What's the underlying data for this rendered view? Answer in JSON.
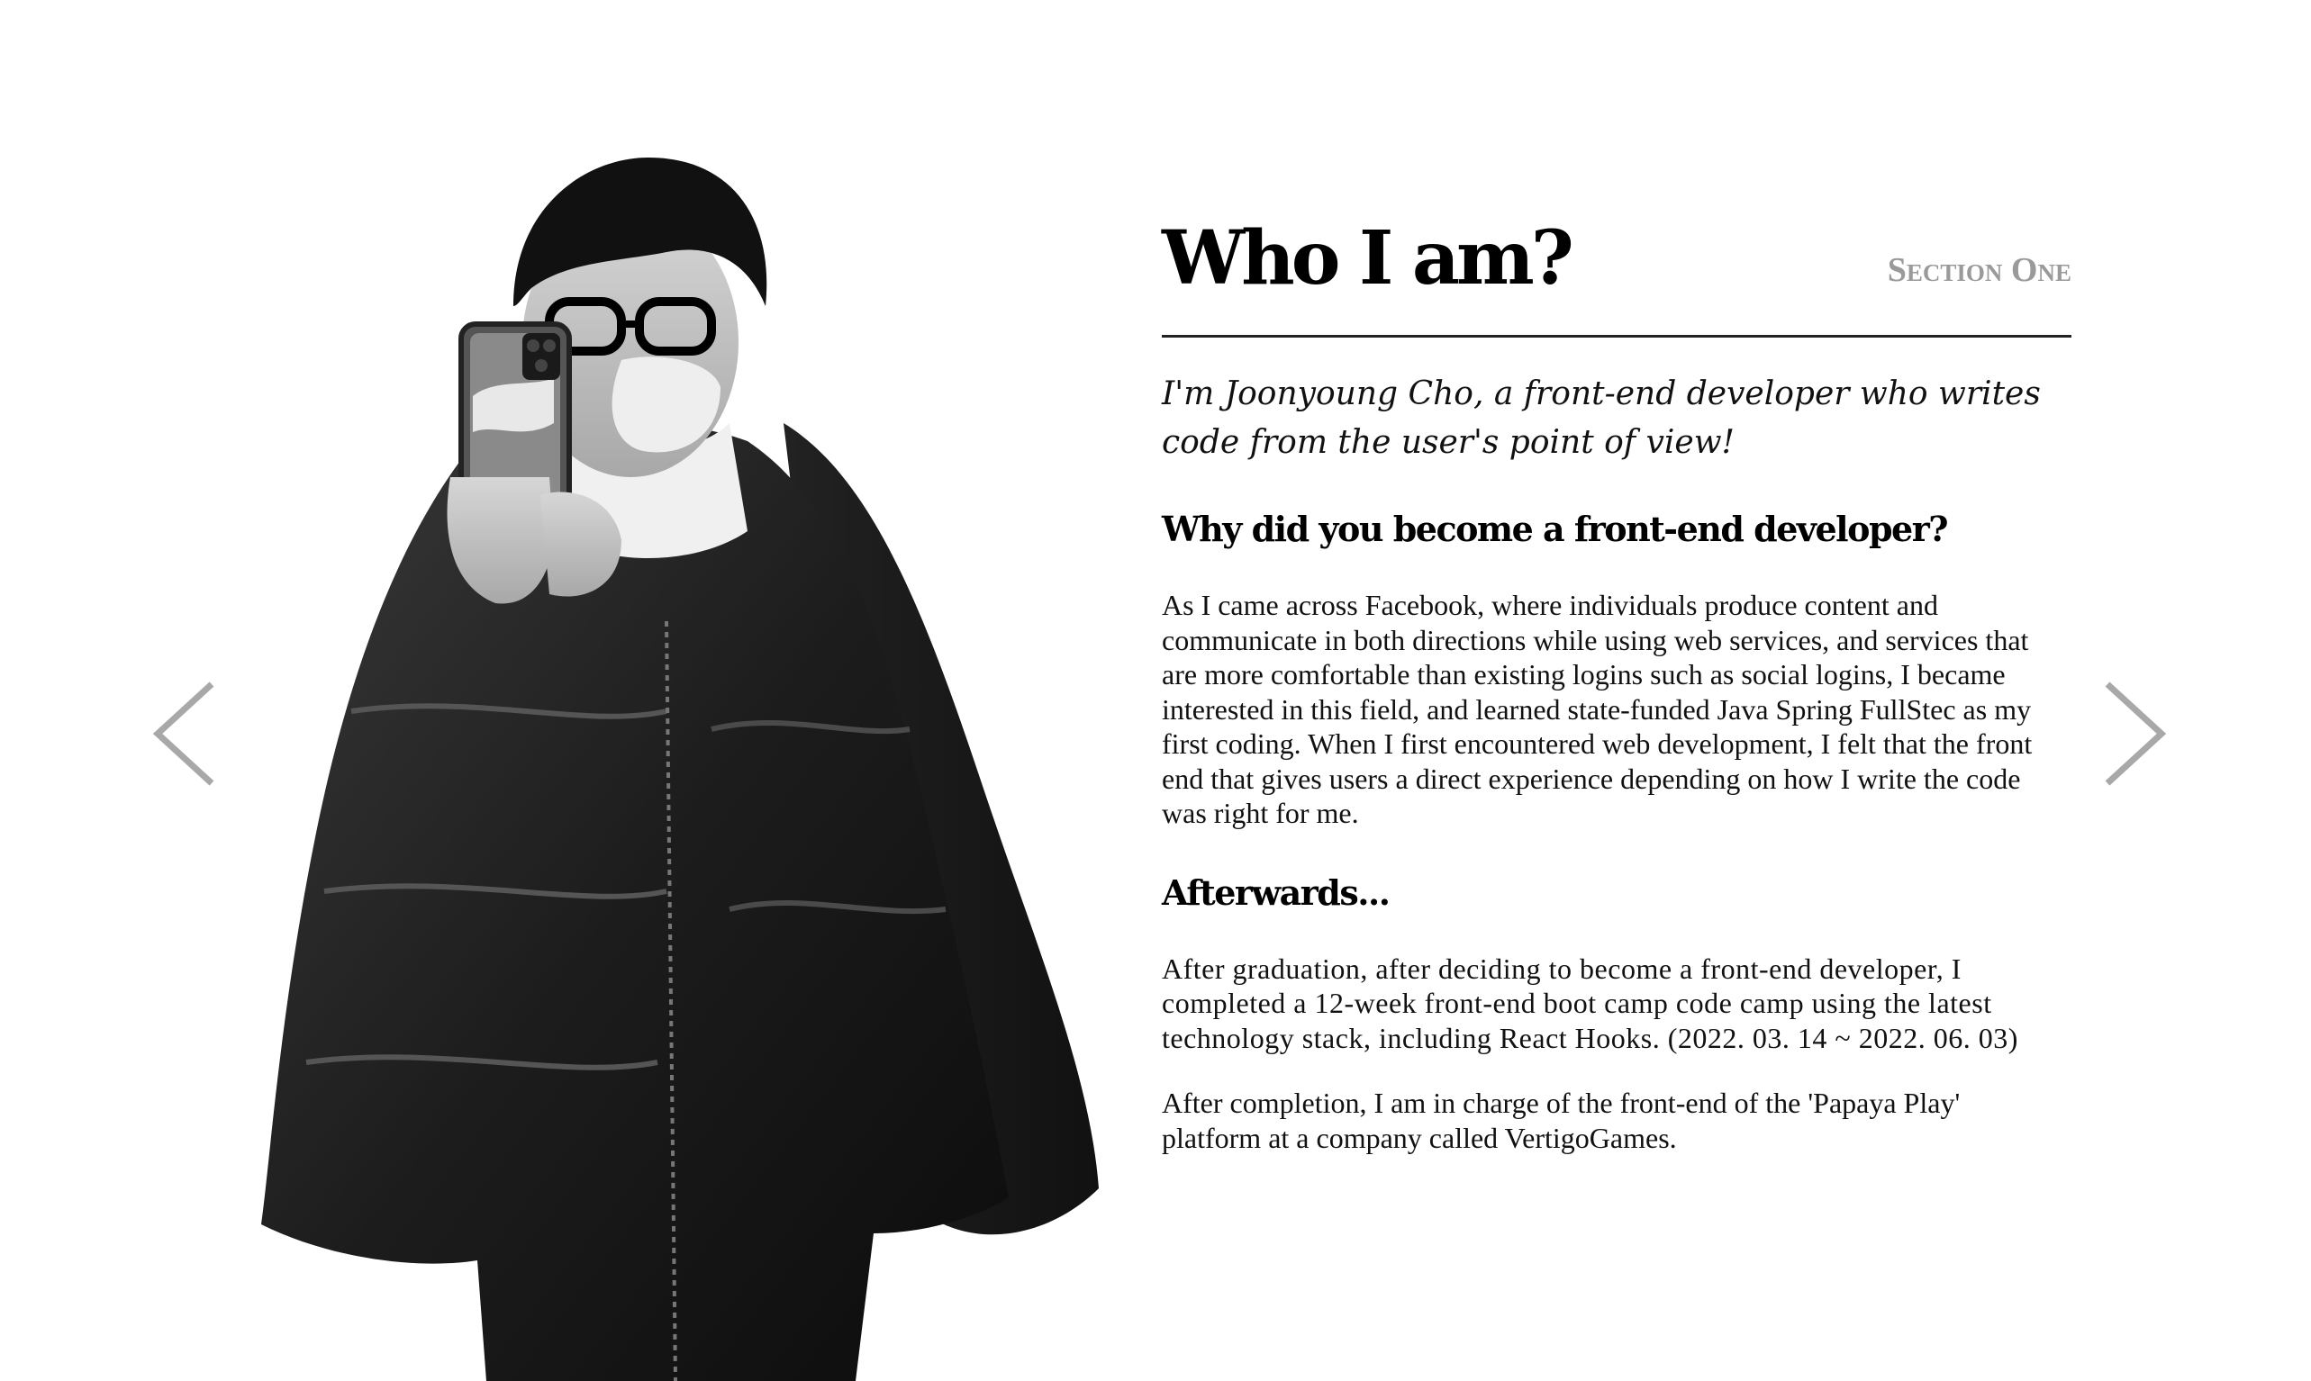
{
  "header": {
    "title": "Who I am?",
    "section_label": "Section One"
  },
  "intro": "I'm Joonyoung Cho, a front-end developer who writes code from the user's point of view!",
  "sections": [
    {
      "heading": "Why did you become a front-end developer?",
      "paragraphs": [
        "As I came across Facebook, where individuals produce content and communicate in both directions while using web services, and services that are more comfortable than existing logins such as social logins, I became interested in this field, and learned state-funded Java Spring FullStec as my first coding. When I first encountered web development, I felt that the front end that gives users a direct experience depending on how I write the code was right for me."
      ]
    },
    {
      "heading": "Afterwards...",
      "paragraphs": [
        "After graduation, after deciding to become a front-end developer, I completed a 12-week front-end boot camp code camp using the latest technology stack, including React Hooks. (2022. 03. 14 ~ 2022. 06. 03)",
        "After completion, I am in charge of the front-end of the 'Papaya Play' platform at a company called VertigoGames."
      ]
    }
  ],
  "navigation": {
    "prev_icon": "chevron-left-icon",
    "next_icon": "chevron-right-icon"
  },
  "colors": {
    "text": "#000000",
    "section_label": "#9a9a9a",
    "arrow": "#a8a8a8",
    "background": "#ffffff"
  }
}
